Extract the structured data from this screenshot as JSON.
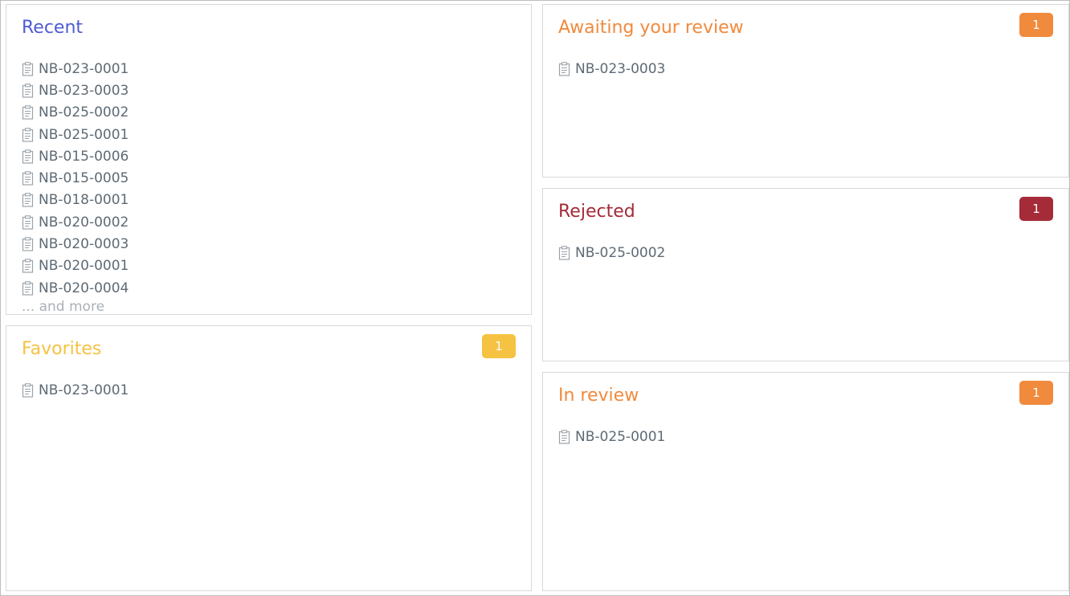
{
  "colors": {
    "recent": "#4f5bd5",
    "favorites": "#f5c242",
    "awaiting": "#f08a3c",
    "rejected": "#a52b38",
    "in_review": "#f08a3c"
  },
  "recent": {
    "title": "Recent",
    "items": [
      {
        "label": "NB-023-0001",
        "icon": "notebook-icon"
      },
      {
        "label": "NB-023-0003",
        "icon": "notebook-icon"
      },
      {
        "label": "NB-025-0002",
        "icon": "notebook-icon"
      },
      {
        "label": "NB-025-0001",
        "icon": "notebook-icon"
      },
      {
        "label": "NB-015-0006",
        "icon": "notebook-icon"
      },
      {
        "label": "NB-015-0005",
        "icon": "notebook-icon"
      },
      {
        "label": "NB-018-0001",
        "icon": "notebook-icon"
      },
      {
        "label": "NB-020-0002",
        "icon": "notebook-icon"
      },
      {
        "label": "NB-020-0003",
        "icon": "notebook-icon"
      },
      {
        "label": "NB-020-0001",
        "icon": "notebook-icon"
      },
      {
        "label": "NB-020-0004",
        "icon": "notebook-icon"
      }
    ],
    "more": "... and more"
  },
  "favorites": {
    "title": "Favorites",
    "count": "1",
    "items": [
      {
        "label": "NB-023-0001",
        "icon": "notebook-icon"
      }
    ]
  },
  "awaiting": {
    "title": "Awaiting your review",
    "count": "1",
    "items": [
      {
        "label": "NB-023-0003",
        "icon": "notebook-icon"
      }
    ]
  },
  "rejected": {
    "title": "Rejected",
    "count": "1",
    "items": [
      {
        "label": "NB-025-0002",
        "icon": "notebook-icon"
      }
    ]
  },
  "in_review": {
    "title": "In review",
    "count": "1",
    "items": [
      {
        "label": "NB-025-0001",
        "icon": "notebook-icon"
      }
    ]
  }
}
